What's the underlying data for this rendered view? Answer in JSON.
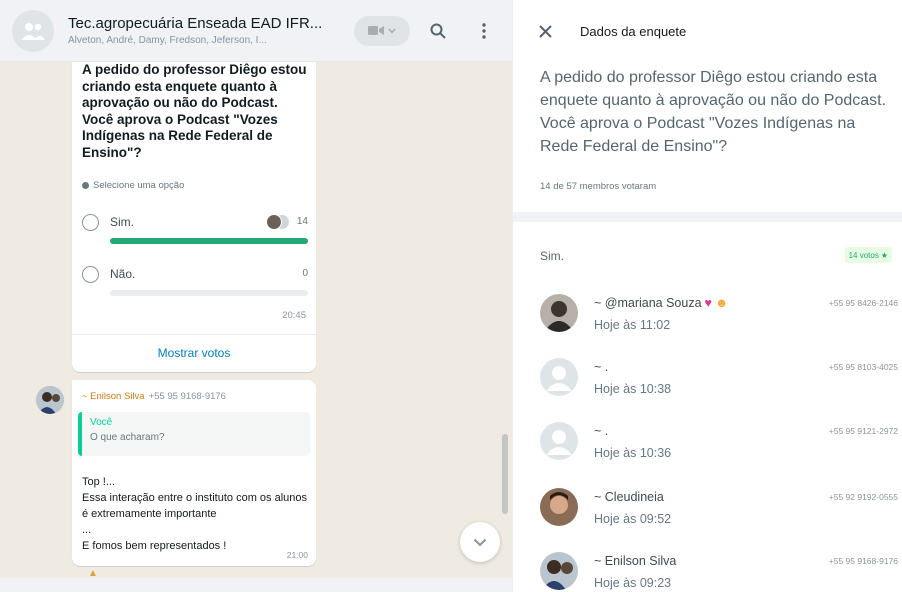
{
  "chat": {
    "title": "Tec.agropecuária Enseada EAD IFR...",
    "participants": "Alveton, André, Damy, Fredson, Jeferson, I...",
    "poll": {
      "question": "A pedido do professor Diêgo estou criando esta enquete quanto à aprovação ou não do Podcast. Você aprova o Podcast \"Vozes Indígenas na Rede Federal de Ensino\"?",
      "hint": "Selecione uma opção",
      "options": [
        {
          "label": "Sim.",
          "count": "14",
          "fraction": 1.0
        },
        {
          "label": "Não.",
          "count": "0",
          "fraction": 0.0
        }
      ],
      "time": "20:45",
      "show_votes": "Mostrar votos"
    },
    "message": {
      "sender": "~ Enilson Silva",
      "phone": "+55 95 9168-9176",
      "quote_author": "Você",
      "quote_text": "O que acharam?",
      "text": "Top !...\nEssa interação entre o instituto com os alunos é extremamente importante\n...\nE fomos bem representados !",
      "time": "21:00"
    }
  },
  "details": {
    "title": "Dados da enquete",
    "question": "A pedido do professor Diêgo estou criando esta enquete quanto à aprovação ou não do Podcast. Você aprova o Podcast \"Vozes Indígenas na Rede Federal de Ensino\"?",
    "voted_count": "14 de 57 membros votaram",
    "option": {
      "label": "Sim.",
      "votes_badge": "14 votos"
    },
    "voters": [
      {
        "name": "~ @mariana Souza",
        "time": "Hoje às 11:02",
        "phone": "+55 95 8426-2146",
        "avatar": "photo"
      },
      {
        "name": "~ .",
        "time": "Hoje às 10:38",
        "phone": "+55 95 8103-4025",
        "avatar": "placeholder"
      },
      {
        "name": "~ .",
        "time": "Hoje às 10:36",
        "phone": "+55 95 9121-2972",
        "avatar": "placeholder"
      },
      {
        "name": "~ Cleudineia",
        "time": "Hoje às 09:52",
        "phone": "+55 92 9192-0555",
        "avatar": "photo"
      },
      {
        "name": "~ Enilson Silva",
        "time": "Hoje às 09:23",
        "phone": "+55 95 9168-9176",
        "avatar": "photo"
      }
    ]
  },
  "colors": {
    "accent_green": "#25a876",
    "chat_background": "#efeae2",
    "link_blue": "#027eb5",
    "sender_name": "#c97b16"
  }
}
